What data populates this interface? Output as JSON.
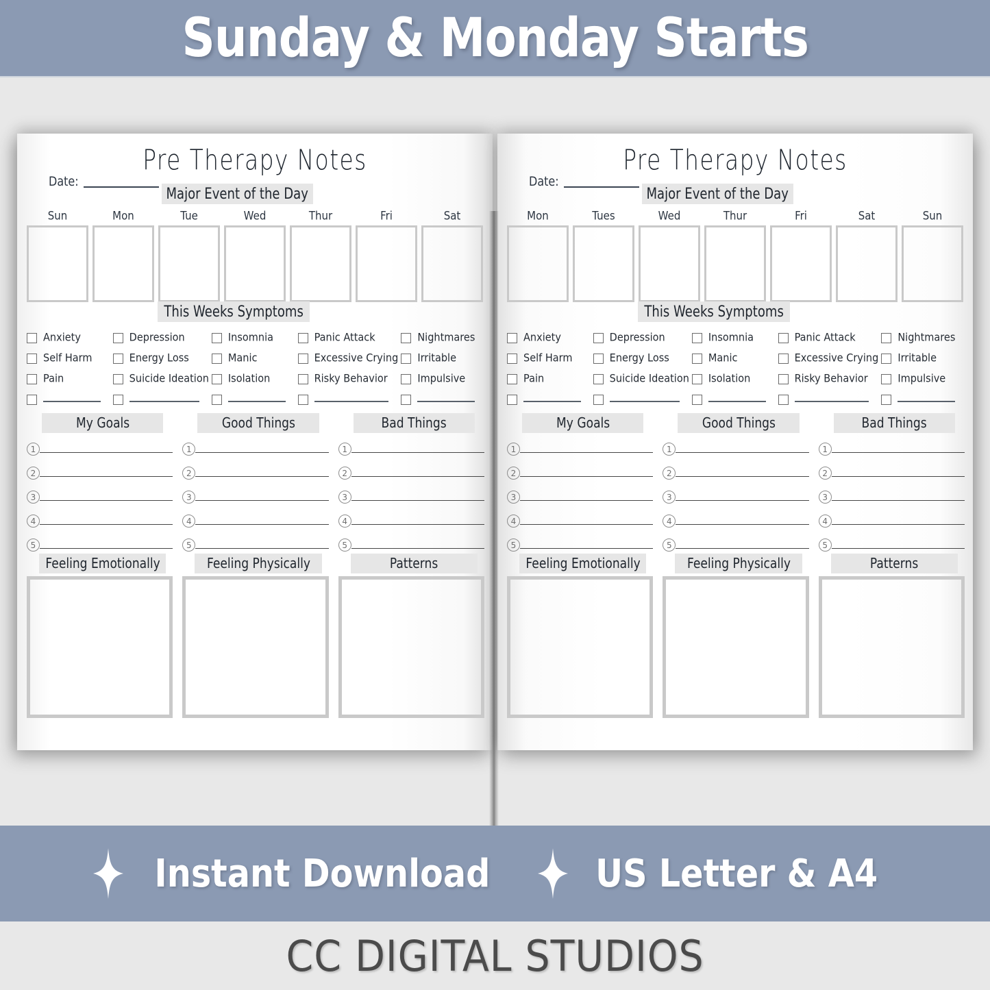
{
  "top_banner": {
    "title": "Sunday & Monday Starts",
    "background": "#8b9ab3"
  },
  "bottom_banner": {
    "background": "#8b9ab3",
    "items": [
      {
        "icon": "sparkle-icon",
        "label": "Instant Download"
      },
      {
        "icon": "sparkle-icon",
        "label": "US Letter & A4"
      }
    ]
  },
  "footer": {
    "brand": "CC DIGITAL STUDIOS"
  },
  "shared": {
    "title": "Pre Therapy Notes",
    "date_label": "Date:",
    "major_event_header": "Major Event of the Day",
    "symptoms_header": "This Weeks Symptoms",
    "symptoms": [
      "Anxiety",
      "Depression",
      "Insomnia",
      "Panic Attack",
      "Nightmares",
      "Self Harm",
      "Energy Loss",
      "Manic",
      "Excessive Crying",
      "Irritable",
      "Pain",
      "Suicide Ideation",
      "Isolation",
      "Risky Behavior",
      "Impulsive"
    ],
    "list_columns": [
      {
        "header": "My Goals",
        "numbers": [
          "1",
          "2",
          "3",
          "4",
          "5"
        ]
      },
      {
        "header": "Good Things",
        "numbers": [
          "1",
          "2",
          "3",
          "4",
          "5"
        ]
      },
      {
        "header": "Bad Things",
        "numbers": [
          "1",
          "2",
          "3",
          "4",
          "5"
        ]
      }
    ],
    "box_columns": [
      {
        "header": "Feeling Emotionally"
      },
      {
        "header": "Feeling Physically"
      },
      {
        "header": "Patterns"
      }
    ],
    "colors": {
      "pill_background": "#e6e6e6",
      "ink": "#2d3642",
      "box_border": "#c9c9c9",
      "page_background": "#ffffff",
      "canvas_background": "#e8e8e8"
    }
  },
  "pages": [
    {
      "id": "sunday-start",
      "days": [
        "Sun",
        "Mon",
        "Tue",
        "Wed",
        "Thur",
        "Fri",
        "Sat"
      ]
    },
    {
      "id": "monday-start",
      "days": [
        "Mon",
        "Tues",
        "Wed",
        "Thur",
        "Fri",
        "Sat",
        "Sun"
      ]
    }
  ]
}
